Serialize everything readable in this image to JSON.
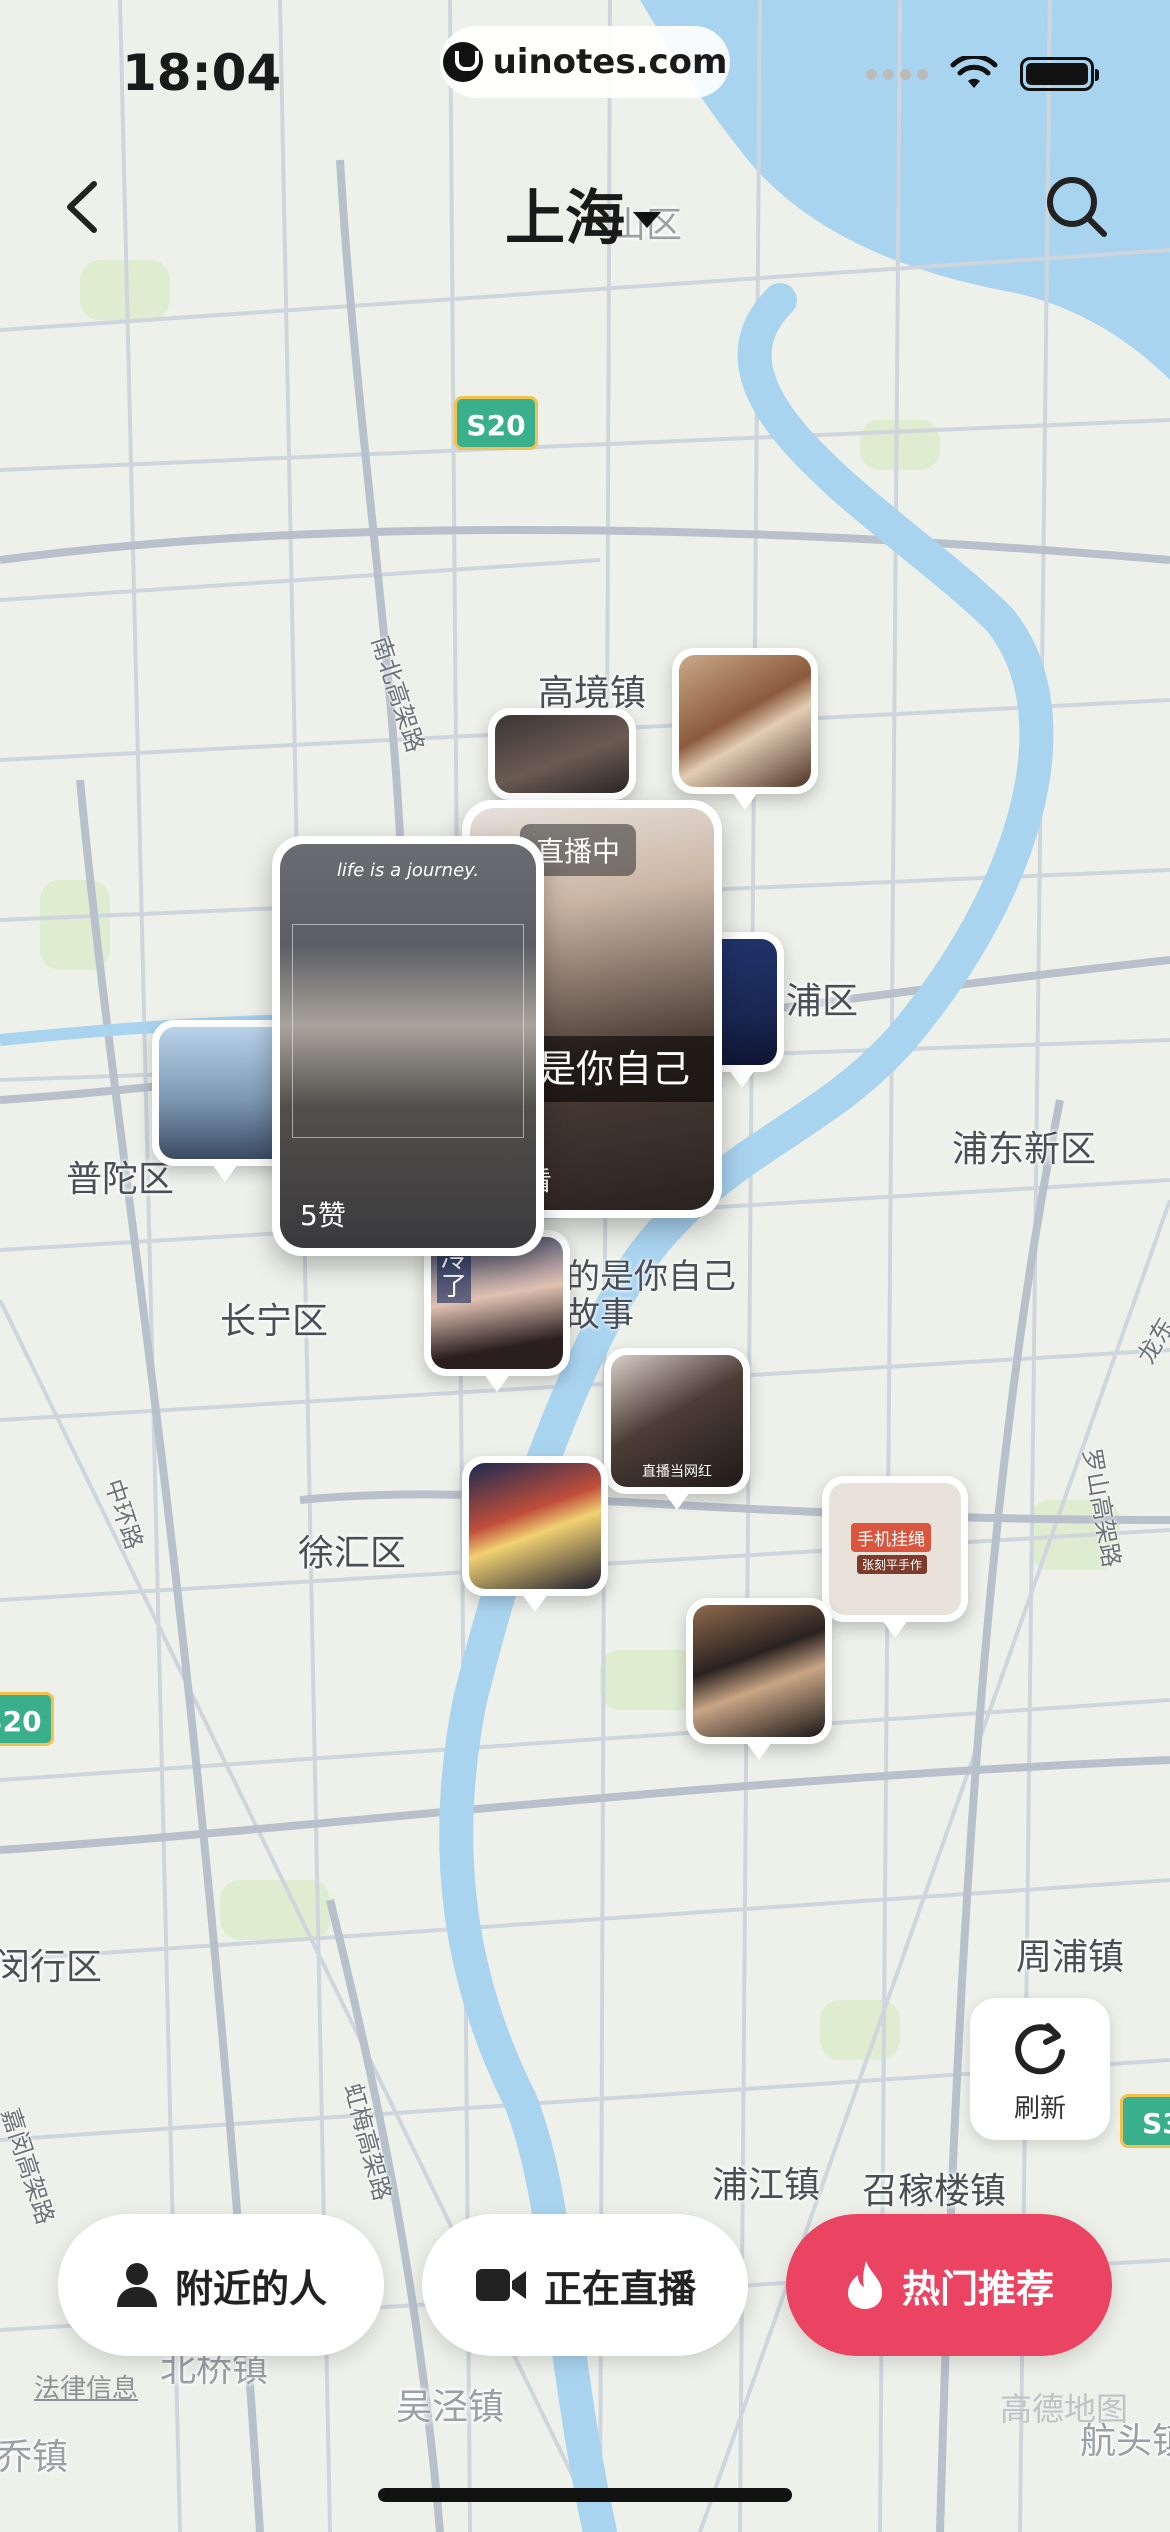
{
  "status_bar": {
    "time": "18:04",
    "url": "uinotes.com"
  },
  "header": {
    "city": "上海"
  },
  "map": {
    "districts": [
      "高境镇",
      "浦区",
      "浦东新区",
      "普陀区",
      "长宁区",
      "徐汇区",
      "闵行区",
      "周浦镇",
      "浦江镇",
      "召稼楼镇",
      "吴泾镇",
      "北桥镇",
      "航头镇",
      "山区",
      "乔镇"
    ],
    "roads": [
      "南北高架路",
      "中环路",
      "虹梅高架路",
      "罗山高架路",
      "嘉闵高架路",
      "龙东"
    ],
    "highway_shields": [
      "S20",
      "S20",
      "S3"
    ],
    "story_caption": "的是你自己\n故事"
  },
  "cards": {
    "live": {
      "badge": "直播中",
      "caption": "的是你自己",
      "viewers": "在看"
    },
    "post": {
      "journey_text": "life is a journey.",
      "likes": "5赞"
    },
    "cold_text": "冷\n了",
    "pin_captions": {
      "influencer": "直播当网红",
      "charm_title": "手机挂绳",
      "charm_sub": "张刻平手作"
    }
  },
  "refresh": {
    "label": "刷新"
  },
  "bottom_buttons": {
    "nearby": "附近的人",
    "live": "正在直播",
    "hot": "热门推荐"
  },
  "attribution": {
    "legal": "法律信息",
    "map_brand": "高德地图"
  },
  "colors": {
    "accent": "#ea4462",
    "water": "#a9d4f0",
    "road": "#bfc6d2"
  },
  "icons": [
    "chevron-left-icon",
    "caret-down-icon",
    "search-icon",
    "refresh-icon",
    "person-icon",
    "video-camera-icon",
    "flame-icon"
  ]
}
